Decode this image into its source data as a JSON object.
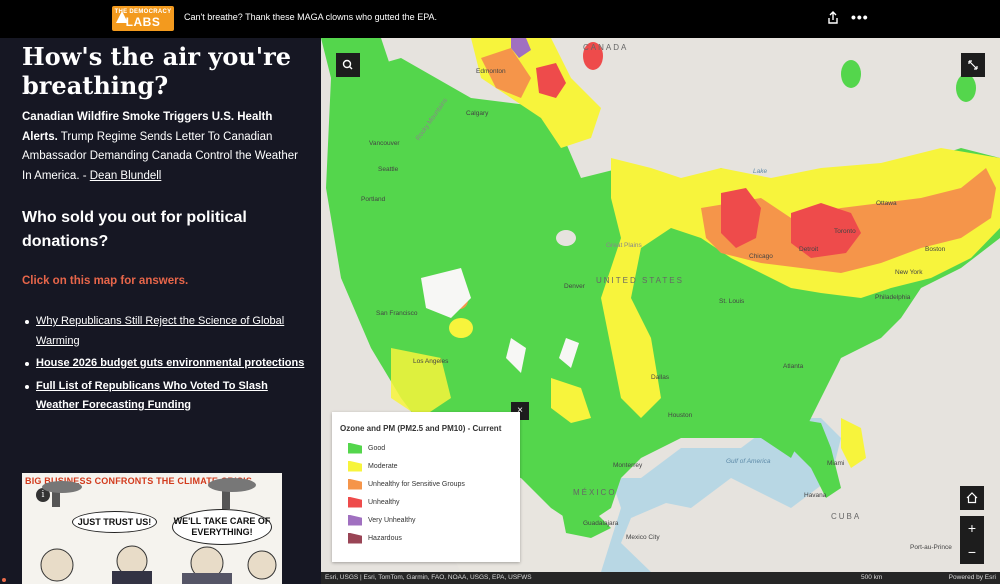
{
  "topbar": {
    "logo_small": "THE DEMOCRACY",
    "logo_big": "LABS",
    "title": "Can't breathe? Thank these MAGA clowns who gutted the EPA."
  },
  "sidebar": {
    "title": "How's the air you're breathing?",
    "para_bold": "Canadian Wildfire Smoke Triggers U.S. Health Alerts.",
    "para_text": " Trump Regime Sends Letter To Canadian Ambassador Demanding Canada Control the Weather In America. - ",
    "para_link": "Dean Blundell",
    "subheading": "Who sold you out for political donations?",
    "click_text": "Click  on this map for answers.",
    "links": [
      {
        "label": "Why Republicans Still Reject the Science of Global Warming"
      },
      {
        "label": "House 2026 budget guts environmental protections"
      },
      {
        "label": "Full List of Republicans Who Voted To Slash Weather Forecasting Funding"
      }
    ],
    "cartoon": {
      "title": "BIG BUSINESS CONFRONTS THE CLIMATE CRISIS",
      "bubble1": "JUST TRUST US!",
      "bubble2": "WE'LL TAKE CARE OF EVERYTHING!",
      "info": "i"
    }
  },
  "map": {
    "labels": {
      "canada": "CANADA",
      "united_states": "UNITED STATES",
      "mexico": "MÉXICO",
      "cuba": "CUBA",
      "gulf": "Gulf of America",
      "edmonton": "Edmonton",
      "calgary": "Calgary",
      "vancouver": "Vancouver",
      "seattle": "Seattle",
      "portland": "Portland",
      "san_francisco": "San Francisco",
      "los_angeles": "Los Angeles",
      "denver": "Denver",
      "dallas": "Dallas",
      "houston": "Houston",
      "monterrey": "Monterrey",
      "guadalajara": "Guadalajara",
      "mexico_city": "Mexico City",
      "chicago": "Chicago",
      "detroit": "Detroit",
      "toronto": "Toronto",
      "ottawa": "Ottawa",
      "boston": "Boston",
      "new_york": "New York",
      "philadelphia": "Philadelphia",
      "st_louis": "St. Louis",
      "atlanta": "Atlanta",
      "miami": "Miami",
      "havana": "Havana",
      "port_au_prince": "Port-au-Prince",
      "great_plains": "Great Plains",
      "rocky_mountains": "Rocky Mountains",
      "lake": "Lake"
    },
    "attribution": "Esri, USGS | Esri, TomTom, Garmin, FAO, NOAA, USGS, EPA, USFWS",
    "scale": "500 km",
    "powered_by": "Powered by Esri",
    "buttons": {
      "search_icon": "search-icon",
      "expand_icon": "expand-icon",
      "home_icon": "home-icon",
      "zoom_in": "+",
      "zoom_out": "−",
      "close": "×"
    }
  },
  "legend": {
    "title": "Ozone and PM (PM2.5 and PM10) - Current",
    "items": [
      {
        "label": "Good",
        "color": "#54d64c"
      },
      {
        "label": "Moderate",
        "color": "#f7f43c"
      },
      {
        "label": "Unhealthy for Sensitive Groups",
        "color": "#f5954a"
      },
      {
        "label": "Unhealthy",
        "color": "#ee4b4b"
      },
      {
        "label": "Very Unhealthy",
        "color": "#a070c0"
      },
      {
        "label": "Hazardous",
        "color": "#994455"
      }
    ]
  }
}
